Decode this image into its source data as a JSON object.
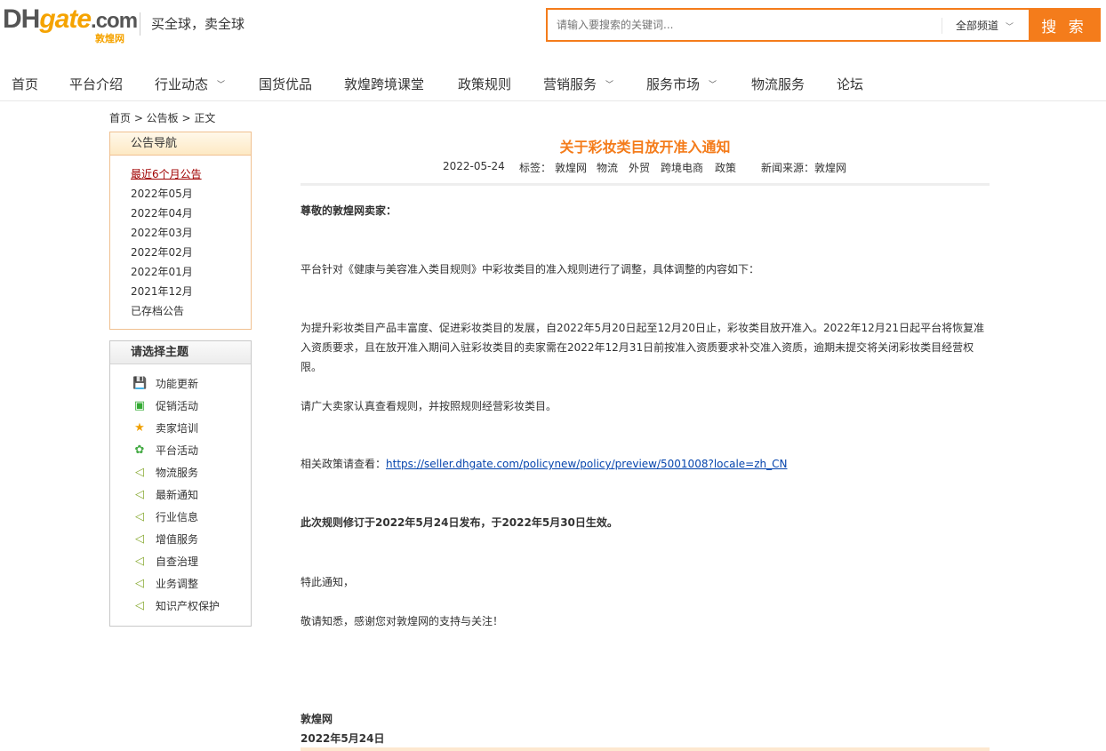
{
  "header": {
    "logo_main": "DH",
    "logo_gate": "gate",
    "logo_com": ".com",
    "logo_cn": "敦煌网",
    "slogan": "买全球，卖全球",
    "search_placeholder": "请输入要搜索的关键词...",
    "search_category": "全部频道",
    "search_button": "搜 索"
  },
  "nav": [
    {
      "label": "首页",
      "dropdown": false
    },
    {
      "label": "平台介绍",
      "dropdown": false
    },
    {
      "label": "行业动态",
      "dropdown": true
    },
    {
      "label": "国货优品",
      "dropdown": false
    },
    {
      "label": "敦煌跨境课堂",
      "dropdown": false
    },
    {
      "label": "政策规则",
      "dropdown": false
    },
    {
      "label": "营销服务",
      "dropdown": true
    },
    {
      "label": "服务市场",
      "dropdown": true
    },
    {
      "label": "物流服务",
      "dropdown": false
    },
    {
      "label": "论坛",
      "dropdown": false
    }
  ],
  "breadcrumb": "首页 > 公告板 > 正文",
  "notice_nav": {
    "title": "公告导航",
    "items": [
      "最近6个月公告",
      "2022年05月",
      "2022年04月",
      "2022年03月",
      "2022年02月",
      "2022年01月",
      "2021年12月",
      "已存档公告"
    ]
  },
  "topics": {
    "title": "请选择主题",
    "items": [
      {
        "label": "功能更新",
        "icon": "save-icon"
      },
      {
        "label": "促销活动",
        "icon": "gift-icon"
      },
      {
        "label": "卖家培训",
        "icon": "star-icon"
      },
      {
        "label": "平台活动",
        "icon": "sprout-icon"
      },
      {
        "label": "物流服务",
        "icon": "speaker-icon"
      },
      {
        "label": "最新通知",
        "icon": "speaker-icon"
      },
      {
        "label": "行业信息",
        "icon": "speaker-icon"
      },
      {
        "label": "增值服务",
        "icon": "speaker-icon"
      },
      {
        "label": "自查治理",
        "icon": "speaker-icon"
      },
      {
        "label": "业务调整",
        "icon": "speaker-icon"
      },
      {
        "label": "知识产权保护",
        "icon": "speaker-icon"
      }
    ]
  },
  "article": {
    "title": "关于彩妆类目放开准入通知",
    "date": "2022-05-24",
    "tags_label": "标签：",
    "tags": [
      "敦煌网",
      "物流",
      "外贸",
      "跨境电商",
      "政策"
    ],
    "source_label": "新闻来源：",
    "source": "敦煌网",
    "greeting": "尊敬的敦煌网卖家：",
    "para1": "平台针对《健康与美容准入类目规则》中彩妆类目的准入规则进行了调整，具体调整的内容如下：",
    "para2": "为提升彩妆类目产品丰富度、促进彩妆类目的发展，自2022年5月20日起至12月20日止，彩妆类目放开准入。2022年12月21日起平台将恢复准入资质要求，且在放开准入期间入驻彩妆类目的卖家需在2022年12月31日前按准入资质要求补交准入资质，逾期未提交将关闭彩妆类目经营权限。",
    "para3": "请广大卖家认真查看规则，并按照规则经营彩妆类目。",
    "policy_label": "相关政策请查看：",
    "policy_link": "https://seller.dhgate.com/policynew/policy/preview/5001008?locale=zh_CN",
    "effective": "此次规则修订于2022年5月24日发布，于2022年5月30日生效。",
    "notice": "特此通知，",
    "thanks": "敬请知悉，感谢您对敦煌网的支持与关注！",
    "sign_org": "敦煌网",
    "sign_date": "2022年5月24日"
  }
}
